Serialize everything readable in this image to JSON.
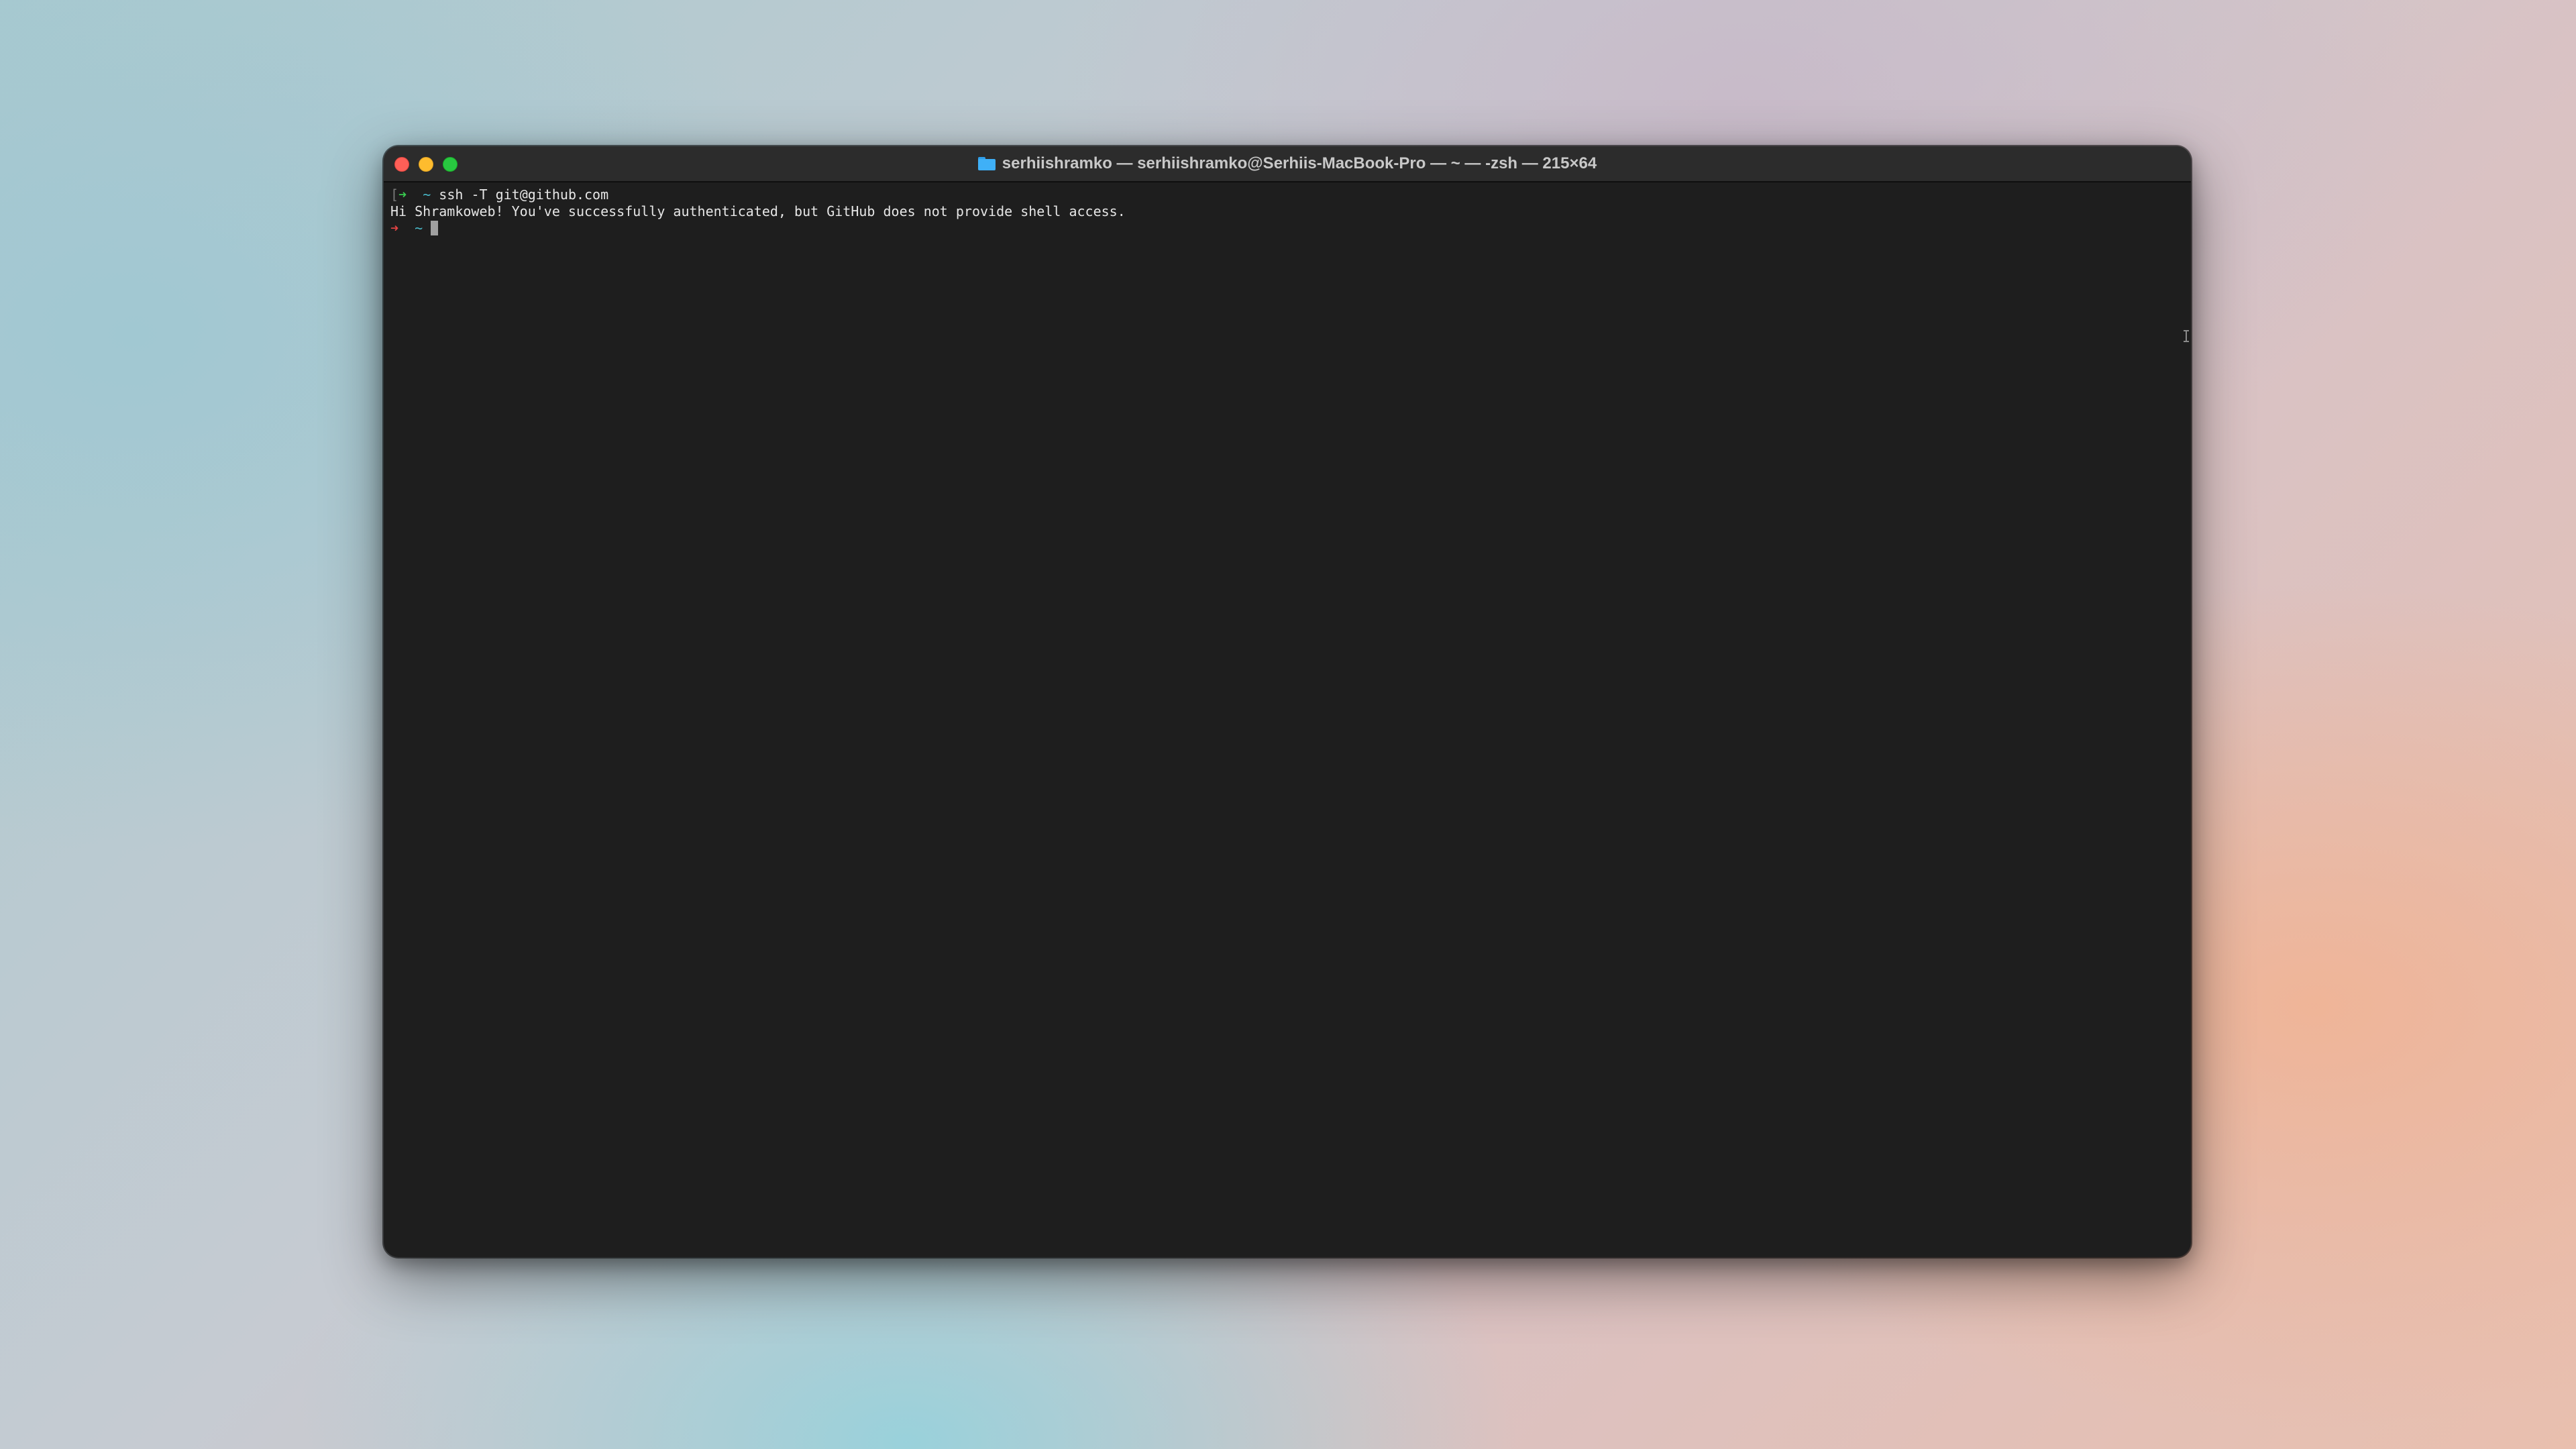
{
  "window": {
    "title": "serhiishramko — serhiishramko@Serhiis-MacBook-Pro — ~ — -zsh — 215×64",
    "title_icon": "folder-icon",
    "controls": [
      "close",
      "minimize",
      "zoom"
    ]
  },
  "terminal": {
    "lines": [
      {
        "mark": "[",
        "prompt_symbol": "➜",
        "cwd": "~",
        "command": "ssh -T git@github.com"
      },
      {
        "output": "Hi Shramkoweb! You've successfully authenticated, but GitHub does not provide shell access."
      },
      {
        "prompt_symbol": "➜",
        "cwd": "~",
        "command": ""
      }
    ]
  },
  "colors": {
    "terminal_background": "#1e1e1e",
    "titlebar_background": "#2c2c2c",
    "prompt_success": "#39c94f",
    "prompt_error": "#e24444",
    "cwd": "#49b9c9",
    "text": "#e6e6e6"
  }
}
